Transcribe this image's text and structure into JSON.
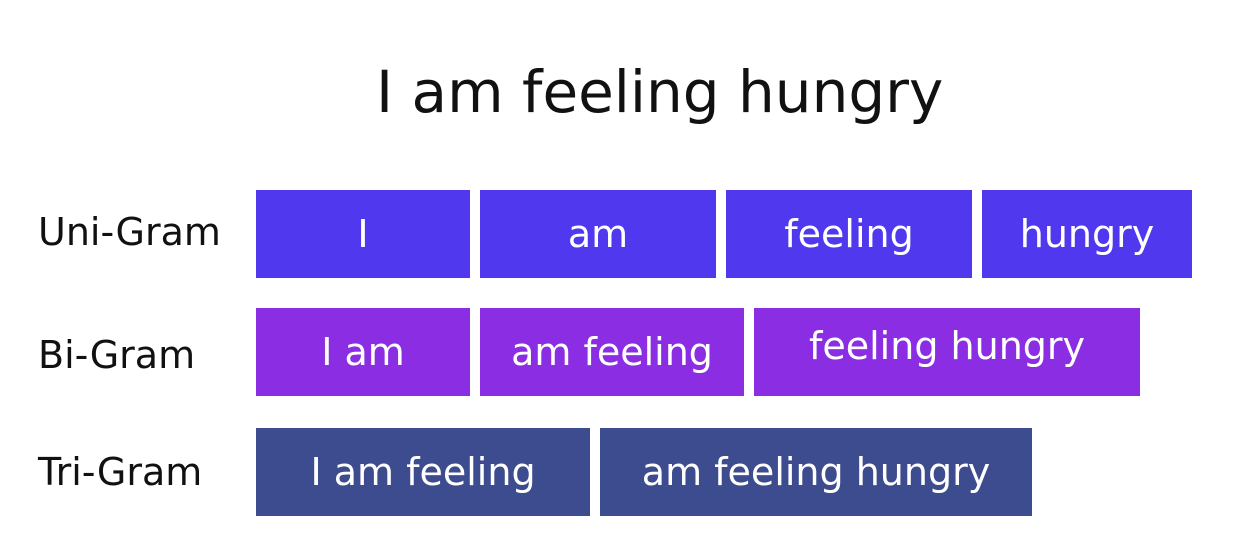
{
  "title": "I am feeling hungry",
  "colors": {
    "unigram": "#5038ee",
    "bigram": "#8b2ee3",
    "trigram": "#3d4b8f"
  },
  "rows": [
    {
      "label": "Uni-Gram",
      "items": [
        "I",
        "am",
        "feeling",
        "hungry"
      ]
    },
    {
      "label": "Bi-Gram",
      "items": [
        "I am",
        "am feeling",
        "feeling hungry"
      ]
    },
    {
      "label": "Tri-Gram",
      "items": [
        "I am feeling",
        "am feeling hungry"
      ]
    }
  ]
}
